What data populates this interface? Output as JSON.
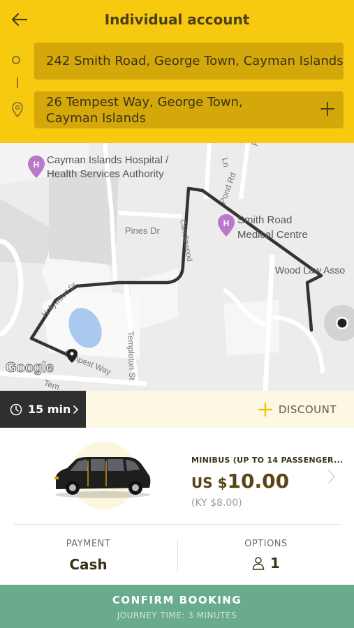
{
  "header": {
    "title": "Individual account",
    "pickup": "242 Smith Road, George Town, Cayman Islands",
    "dropoff_line1": "26 Tempest Way, George Town,",
    "dropoff_line2": "Cayman Islands",
    "background_color": "#f7c90f"
  },
  "map": {
    "places": {
      "hospital_line1": "Cayman Islands Hospital /",
      "hospital_line2": "Health Services Authority",
      "medical_line1": "Smith Road",
      "medical_line2": "Medical Centre",
      "wood_law": "Wood Law Asso"
    },
    "streets": {
      "pines": "Pines Dr",
      "pond": "Pond Rd",
      "templeton": "Templeton St",
      "tempest": "Tempest Way",
      "candlewood": "Candlewood",
      "hollywood": "Hollywood Dr",
      "ln": "Ln",
      "po": "Po",
      "tem": "Tem"
    },
    "attribution": "Google"
  },
  "eta": {
    "text": "15 min"
  },
  "discount": {
    "label": "DISCOUNT"
  },
  "vehicle": {
    "name": "MINIBUS (UP TO 14 PASSENGER...",
    "currency": "US $",
    "amount": "10.00",
    "secondary_price": "(KY $8.00)"
  },
  "payment": {
    "label": "PAYMENT",
    "value": "Cash"
  },
  "options": {
    "label": "OPTIONS",
    "passengers": "1"
  },
  "confirm": {
    "label": "CONFIRM BOOKING",
    "journey_time": "JOURNEY TIME: 3 MINUTES",
    "color": "#6aab8d"
  }
}
